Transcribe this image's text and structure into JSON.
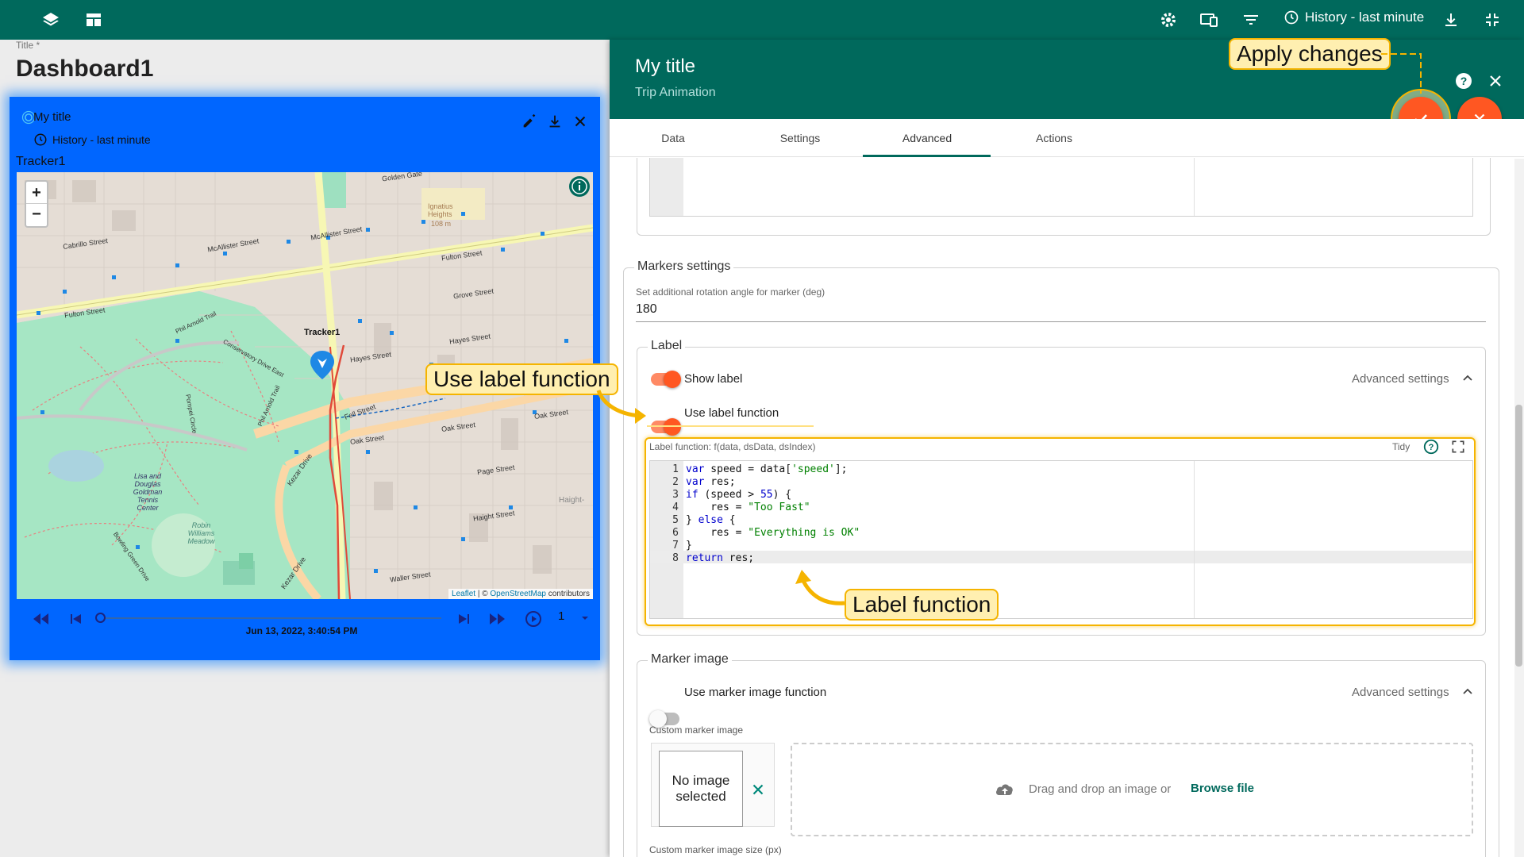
{
  "topbar": {
    "history_label": "History - last minute"
  },
  "dashboard": {
    "title_label": "Title *",
    "title": "Dashboard1"
  },
  "widget": {
    "title": "My title",
    "history": "History - last minute",
    "tracker": "Tracker1",
    "map_labels": {
      "cabrillo": "Cabrillo Street",
      "mcallister1": "McAllister Street",
      "mcallister2": "McAllister Street",
      "fulton1": "Fulton Street",
      "fulton2": "Fulton Street",
      "golden_gate": "Golden Gate",
      "ignatius": "Ignatius Heights",
      "ignatius_elev": "108 m",
      "grove": "Grove Street",
      "hayes1": "Hayes Street",
      "hayes2": "Hayes Street",
      "fell": "Fell Street",
      "oak1": "Oak Street",
      "oak2": "Oak Street",
      "oak3": "Oak Street",
      "page": "Page Street",
      "haight": "Haight Street",
      "haight_ash": "Haight-",
      "waller": "Waller Street",
      "kezar_drive": "Kezar Drive",
      "kezar_drive2": "Kezar Drive",
      "conservatory": "Conservatory Drive East",
      "phil_arnold": "Phil Arnold Trail",
      "phil_arnold2": "Phil Arnold Trail",
      "pompei": "Pompei Circle",
      "lisa": "Lisa and Douglas Goldman Tennis Center",
      "robin": "Robin Williams Meadow",
      "bowling": "Bowling Green Drive",
      "marker_label": "Tracker1",
      "attribution_leaflet": "Leaflet",
      "attribution_sep": " | © ",
      "attribution_osm": "OpenStreetMap",
      "attribution_rest": " contributors",
      "zoom_in": "+",
      "zoom_out": "−"
    },
    "playback": {
      "date": "Jun 13, 2022, 3:40:54 PM",
      "speed": "1",
      "progress": 0
    }
  },
  "panel": {
    "title": "My title",
    "subtitle": "Trip Animation",
    "tabs": [
      "Data",
      "Settings",
      "Advanced",
      "Actions"
    ],
    "markers_settings": {
      "legend": "Markers settings",
      "rotation_label": "Set additional rotation angle for marker (deg)",
      "rotation_value": "180"
    },
    "label": {
      "legend": "Label",
      "show_label": "Show label",
      "advanced_settings": "Advanced settings",
      "use_label_function": "Use label function",
      "function_label": "Label function: f(data, dsData, dsIndex)",
      "tidy": "Tidy",
      "gutter": [
        "1",
        "2",
        "3",
        "4",
        "5",
        "6",
        "7",
        "8"
      ],
      "code": [
        "var speed = data['speed'];",
        "var res;",
        "if (speed > 55) {",
        "    res = \"Too Fast\"",
        "} else {",
        "    res = \"Everything is OK\"",
        "}",
        "return res;"
      ]
    },
    "marker_image": {
      "legend": "Marker image",
      "use_function": "Use marker image function",
      "advanced_settings": "Advanced settings",
      "custom_label": "Custom marker image",
      "no_image": "No image selected",
      "drag_drop": "Drag and drop an image or",
      "browse": "Browse file",
      "size_label": "Custom marker image size (px)"
    }
  },
  "callouts": {
    "apply_changes": "Apply changes",
    "use_label_function": "Use label function",
    "label_function": "Label function"
  },
  "colors": {
    "header": "#00695c",
    "widget_bg": "#0066ff",
    "accent": "#ff5722",
    "callout_bg": "#ffefb0",
    "callout_border": "#f5b400"
  }
}
